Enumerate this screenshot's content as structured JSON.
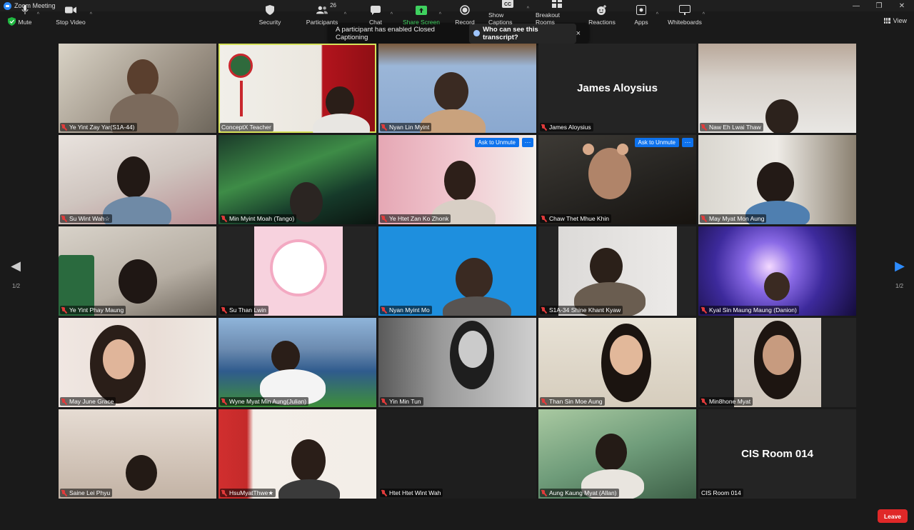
{
  "window": {
    "title": "Zoom Meeting",
    "controls": [
      "—",
      "❐",
      "✕"
    ]
  },
  "view_label": "View",
  "toast": {
    "message": "A participant has enabled Closed Captioning",
    "link": "Who can see this transcript?",
    "close": "×"
  },
  "pagination": {
    "left": "1/2",
    "right": "1/2"
  },
  "tiles": [
    {
      "name": "Ye Yint Zay Yar(S1A-44)",
      "muted": true
    },
    {
      "name": "ConceptX Teacher",
      "muted": false,
      "active": true
    },
    {
      "name": "Nyan Lin Myint",
      "muted": true
    },
    {
      "name": "James Aloysius",
      "muted": true,
      "video_off": true
    },
    {
      "name": "Naw Eh Lwai  Thaw",
      "muted": true
    },
    {
      "name": "Su Wint Wah☆",
      "muted": true
    },
    {
      "name": "Min Myint Moah (Tango)",
      "muted": true
    },
    {
      "name": "Ye Htet Zan Ko Zhonk",
      "muted": true,
      "ask_to_unmute": "Ask to Unmute",
      "more": "···"
    },
    {
      "name": "Chaw Thet Mhue Khin",
      "muted": true,
      "ask_to_unmute": "Ask to Unmute",
      "more": "···"
    },
    {
      "name": "May Myat Mon Aung",
      "muted": true
    },
    {
      "name": "Ye Yint Phay Maung",
      "muted": true
    },
    {
      "name": "Su Than Lwin",
      "muted": true
    },
    {
      "name": "Nyan Myint Mo",
      "muted": true
    },
    {
      "name": "S1A-34 Shine Khant Kyaw",
      "muted": true
    },
    {
      "name": "Kyal Sin Maung Maung (Danion)",
      "muted": true
    },
    {
      "name": "May June Grace",
      "muted": true
    },
    {
      "name": "Wyne Myat Min Aung(Julian)",
      "muted": true
    },
    {
      "name": "Yin Min Tun",
      "muted": true
    },
    {
      "name": "Than Sin Moe Aung",
      "muted": true
    },
    {
      "name": "Min8hone Myat",
      "muted": true
    },
    {
      "name": "Saine Lei Phyu",
      "muted": true
    },
    {
      "name": "HsuMyatThwe★",
      "muted": true
    },
    {
      "name": "Htet Htet Wint Wah",
      "muted": true,
      "video_off": true
    },
    {
      "name": "Aung Kaung Myat (Allan)",
      "muted": true
    },
    {
      "name": "CIS Room 014",
      "muted": false,
      "video_off": true
    }
  ],
  "toolbar": {
    "mute": "Mute",
    "stop_video": "Stop Video",
    "security": "Security",
    "participants": "Participants",
    "participants_count": "26",
    "chat": "Chat",
    "share_screen": "Share Screen",
    "record": "Record",
    "show_captions": "Show Captions",
    "breakout_rooms": "Breakout Rooms",
    "reactions": "Reactions",
    "apps": "Apps",
    "whiteboards": "Whiteboards",
    "leave": "Leave"
  },
  "colors": {
    "accent_blue": "#0e72ed",
    "active_speaker": "#d6e25a",
    "leave_red": "#e02828",
    "share_green": "#3fd15f"
  }
}
